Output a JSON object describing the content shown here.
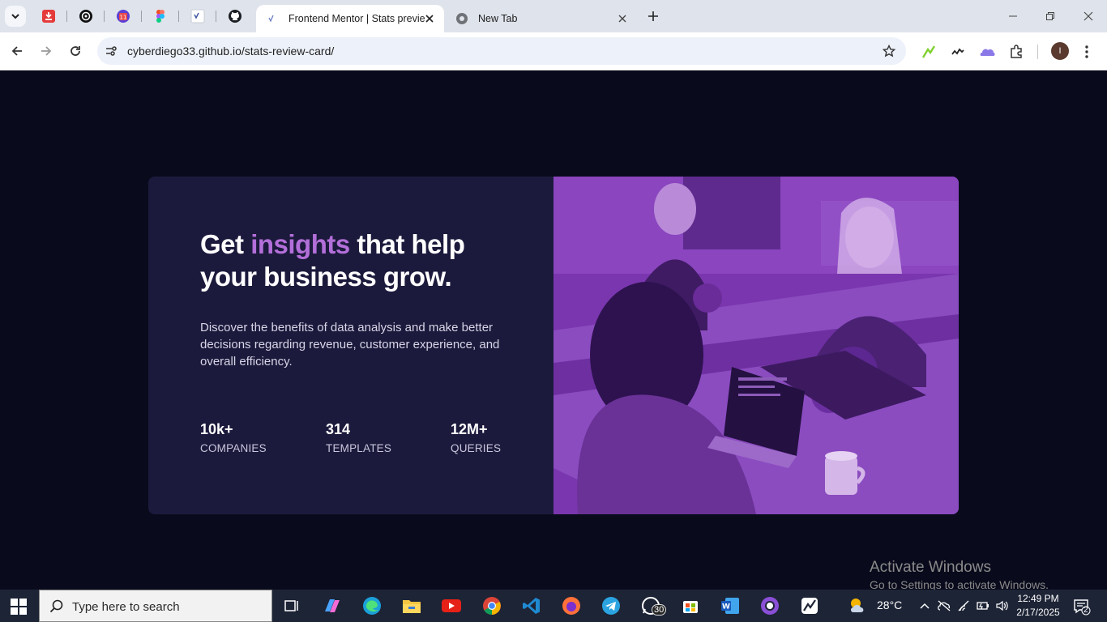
{
  "browser": {
    "tabs": [
      {
        "title": "Frontend Mentor | Stats preview card component",
        "active": true
      },
      {
        "title": "New Tab",
        "active": false
      }
    ],
    "url": "cyberdiego33.github.io/stats-review-card/",
    "profile_initial": "I",
    "pinned_icons": [
      "download-icon",
      "chatgpt-icon",
      "calendar-icon",
      "figma-icon",
      "frontend-mentor-icon",
      "github-icon"
    ],
    "extension_icons": [
      "speed-extension-icon",
      "waveform-extension-icon",
      "cloud-extension-icon",
      "puzzle-icon"
    ]
  },
  "card": {
    "headline_start": "Get ",
    "headline_accent": "insights",
    "headline_end": " that help your business grow.",
    "description": "Discover the benefits of data analysis and make better decisions regarding revenue, customer experience, and overall efficiency.",
    "stats": [
      {
        "value": "10k+",
        "label": "COMPANIES"
      },
      {
        "value": "314",
        "label": "TEMPLATES"
      },
      {
        "value": "12M+",
        "label": "QUERIES"
      }
    ],
    "colors": {
      "background": "#090b1c",
      "card": "#1c1a3c",
      "accent": "#b36fd9",
      "image_tint": "#7a37b0"
    }
  },
  "watermark": {
    "title": "Activate Windows",
    "subtitle": "Go to Settings to activate Windows."
  },
  "taskbar": {
    "search_placeholder": "Type here to search",
    "whatsapp_badge": "30",
    "temperature": "28°C",
    "time": "12:49 PM",
    "date": "2/17/2025",
    "notification_count": "2"
  }
}
